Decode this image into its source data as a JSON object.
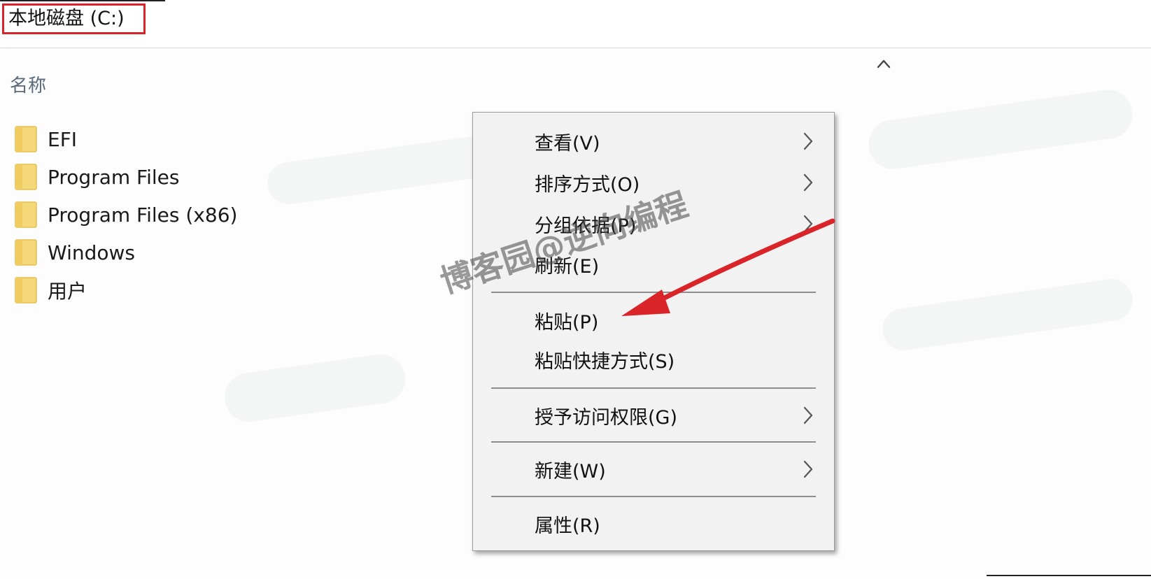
{
  "breadcrumb": {
    "label": "本地磁盘 (C:)",
    "highlight_color": "#d9252a"
  },
  "column_header": {
    "name_label": "名称",
    "sort_icon": "chevron-up-icon"
  },
  "files": [
    {
      "name": "EFI",
      "icon": "folder-icon"
    },
    {
      "name": "Program Files",
      "icon": "folder-icon"
    },
    {
      "name": "Program Files (x86)",
      "icon": "folder-icon"
    },
    {
      "name": "Windows",
      "icon": "folder-icon"
    },
    {
      "name": "用户",
      "icon": "folder-icon"
    }
  ],
  "context_menu": {
    "items": [
      {
        "label": "查看(V)",
        "has_submenu": true
      },
      {
        "label": "排序方式(O)",
        "has_submenu": true
      },
      {
        "label": "分组依据(P)",
        "has_submenu": true
      },
      {
        "label": "刷新(E)",
        "has_submenu": false
      },
      {
        "label": "粘贴(P)",
        "has_submenu": false
      },
      {
        "label": "粘贴快捷方式(S)",
        "has_submenu": false
      },
      {
        "label": "授予访问权限(G)",
        "has_submenu": true
      },
      {
        "label": "新建(W)",
        "has_submenu": true
      },
      {
        "label": "属性(R)",
        "has_submenu": false
      }
    ]
  },
  "watermark": {
    "text": "博客园@逆向编程"
  },
  "annotation": {
    "arrow_color": "#d9252a",
    "points_to": "粘贴(P)"
  },
  "colors": {
    "folder": "#f5d878",
    "folder_dark": "#e3bf55",
    "menu_bg": "#f2f2f2"
  }
}
